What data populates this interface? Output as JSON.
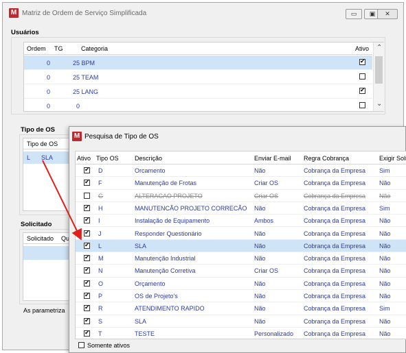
{
  "main_window": {
    "title": "Matriz de Ordem de Serviço Simplificada",
    "logo": "M",
    "controls": [
      "▭",
      "▣",
      "✕"
    ]
  },
  "usuarios": {
    "label": "Usuários",
    "headers": [
      "Ordem",
      "TG",
      "Categoria",
      "Ativo"
    ],
    "rows": [
      {
        "ordem": "0",
        "categoria": "25 BPM",
        "ativo": true
      },
      {
        "ordem": "0",
        "categoria": "25 TEAM",
        "ativo": false
      },
      {
        "ordem": "0",
        "categoria": "25 LANG",
        "ativo": true
      },
      {
        "ordem": "0",
        "categoria": "0",
        "ativo": false
      }
    ],
    "scroll_up": "⌃",
    "scroll_down": "⌄"
  },
  "tipo_os": {
    "label": "Tipo de OS",
    "header": "Tipo de OS",
    "row": {
      "code": "L",
      "name": "SLA"
    }
  },
  "solicitado": {
    "label": "Solicitado",
    "headers": [
      "Solicitado",
      "Qu"
    ]
  },
  "footer_text": "As parametriza",
  "dialog": {
    "title": "Pesquisa de Tipo de OS",
    "headers": [
      "Ativo",
      "Tipo OS",
      "Descrição",
      "Enviar E-mail",
      "Regra Cobrança",
      "Exigir Soli"
    ],
    "rows": [
      {
        "ativo": true,
        "tipo": "D",
        "desc": "Orcamento",
        "email": "Não",
        "regra": "Cobrança da Empresa",
        "exigir": "Sim",
        "strike": false,
        "selected": false
      },
      {
        "ativo": true,
        "tipo": "F",
        "desc": "Manutenção de Frotas",
        "email": "Criar OS",
        "regra": "Cobrança da Empresa",
        "exigir": "Não",
        "strike": false,
        "selected": false
      },
      {
        "ativo": false,
        "tipo": "G",
        "desc": "ALTERACAO PROJETO",
        "email": "Criar OS",
        "regra": "Cobrança da Empresa",
        "exigir": "Não",
        "strike": true,
        "selected": false
      },
      {
        "ativo": true,
        "tipo": "H",
        "desc": "MANUTENCÃO PROJETO  CORRECÃO",
        "email": "Não",
        "regra": "Cobrança da Empresa",
        "exigir": "Sim",
        "strike": false,
        "selected": false
      },
      {
        "ativo": true,
        "tipo": "I",
        "desc": "Instalação de Equipamento",
        "email": "Ambos",
        "regra": "Cobrança da Empresa",
        "exigir": "Não",
        "strike": false,
        "selected": false
      },
      {
        "ativo": true,
        "tipo": "J",
        "desc": "Responder Questionário",
        "email": "Não",
        "regra": "Cobrança da Empresa",
        "exigir": "Não",
        "strike": false,
        "selected": false
      },
      {
        "ativo": true,
        "tipo": "L",
        "desc": "SLA",
        "email": "Não",
        "regra": "Cobrança da Empresa",
        "exigir": "Não",
        "strike": false,
        "selected": true
      },
      {
        "ativo": true,
        "tipo": "M",
        "desc": "Manutenção Industrial",
        "email": "Não",
        "regra": "Cobrança da Empresa",
        "exigir": "Não",
        "strike": false,
        "selected": false
      },
      {
        "ativo": true,
        "tipo": "N",
        "desc": "Manutenção Corretiva",
        "email": "Criar OS",
        "regra": "Cobrança da Empresa",
        "exigir": "Não",
        "strike": false,
        "selected": false
      },
      {
        "ativo": true,
        "tipo": "O",
        "desc": "Orçamento",
        "email": "Não",
        "regra": "Cobrança da Empresa",
        "exigir": "Não",
        "strike": false,
        "selected": false
      },
      {
        "ativo": true,
        "tipo": "P",
        "desc": "OS de Projeto's",
        "email": "Não",
        "regra": "Cobrança da Empresa",
        "exigir": "Não",
        "strike": false,
        "selected": false
      },
      {
        "ativo": true,
        "tipo": "R",
        "desc": "ATENDIMENTO RAPIDO",
        "email": "Não",
        "regra": "Cobrança da Empresa",
        "exigir": "Sim",
        "strike": false,
        "selected": false
      },
      {
        "ativo": true,
        "tipo": "S",
        "desc": "SLA",
        "email": "Não",
        "regra": "Cobrança da Empresa",
        "exigir": "Não",
        "strike": false,
        "selected": false
      },
      {
        "ativo": true,
        "tipo": "T",
        "desc": "TESTE",
        "email": "Personalizado",
        "regra": "Cobrança da Empresa",
        "exigir": "Não",
        "strike": false,
        "selected": false
      }
    ],
    "somente_ativos": {
      "label": "Somente ativos",
      "checked": false
    }
  },
  "annotation_arrow_color": "#e0201a"
}
